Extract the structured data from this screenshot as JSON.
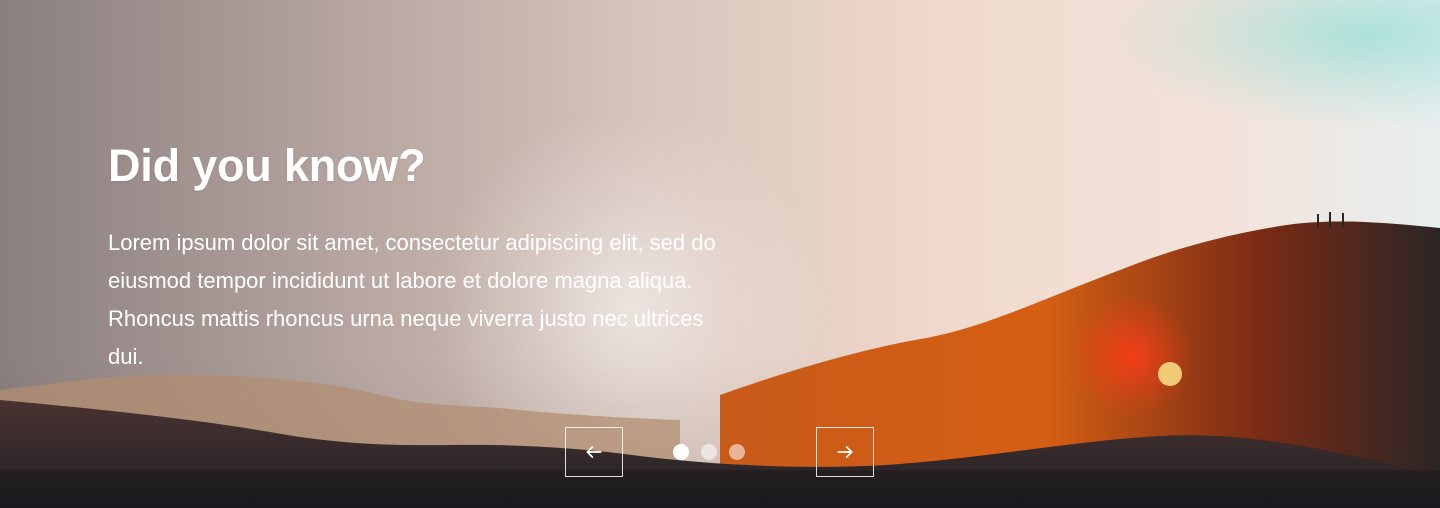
{
  "hero": {
    "title": "Did you know?",
    "body": "Lorem ipsum dolor sit amet, consectetur adipiscing elit, sed do eiusmod tempor incididunt ut labore et dolore magna aliqua. Rhoncus mattis rhoncus urna neque viverra justo nec ultrices dui."
  },
  "carousel": {
    "prev_icon": "arrow-left-icon",
    "next_icon": "arrow-right-icon",
    "total_slides": 3,
    "active_slide": 1
  },
  "colors": {
    "text": "#ffffff",
    "sun": "#f6d27a",
    "sun_glare": "#ff3b1a"
  }
}
